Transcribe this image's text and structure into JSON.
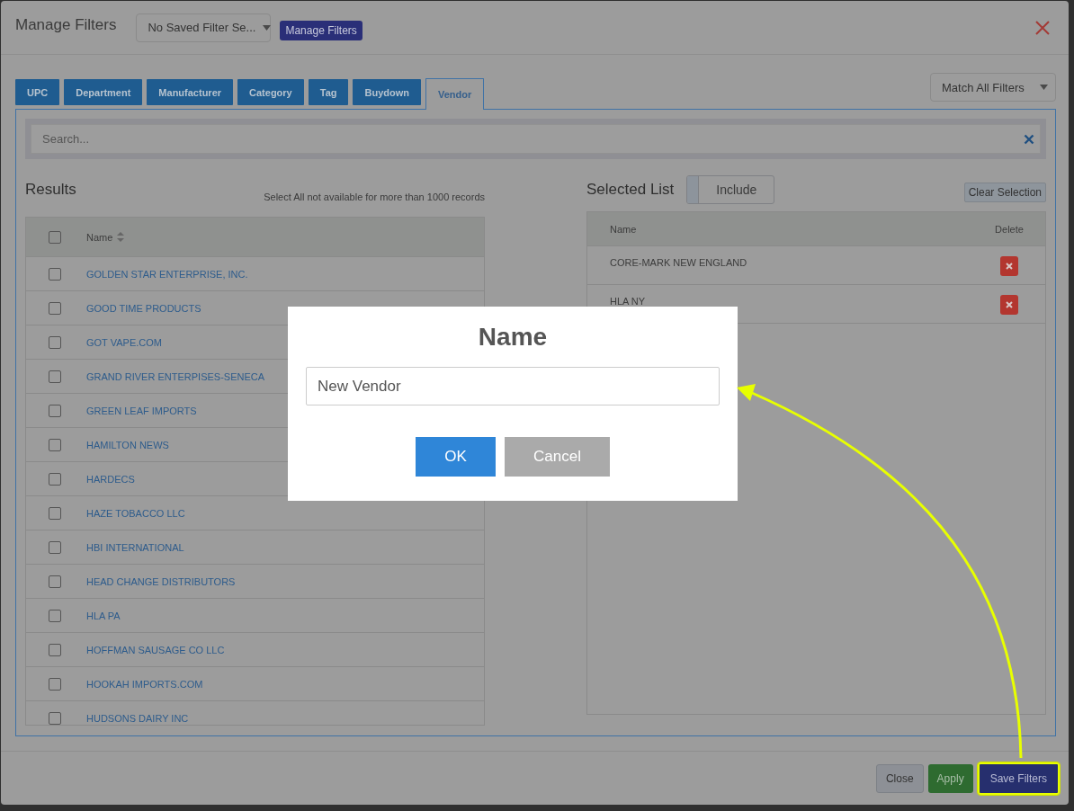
{
  "header": {
    "title": "Manage Filters",
    "saved_filter_select": {
      "value": "No Saved Filter Se..."
    },
    "manage_button": "Manage Filters"
  },
  "tabs": [
    {
      "label": "UPC",
      "selected": false
    },
    {
      "label": "Department",
      "selected": false
    },
    {
      "label": "Manufacturer",
      "selected": false
    },
    {
      "label": "Category",
      "selected": false
    },
    {
      "label": "Tag",
      "selected": false
    },
    {
      "label": "Buydown",
      "selected": false
    },
    {
      "label": "Vendor",
      "selected": true
    }
  ],
  "match_select": {
    "value": "Match All Filters"
  },
  "search": {
    "placeholder": "Search..."
  },
  "results": {
    "title": "Results",
    "note": "Select All not available for more than 1000 records",
    "column": "Name",
    "select_all_checked": false,
    "rows": [
      {
        "name": "GOLDEN STAR ENTERPRISE, INC.",
        "checked": false
      },
      {
        "name": "GOOD TIME PRODUCTS",
        "checked": false
      },
      {
        "name": "GOT VAPE.COM",
        "checked": false
      },
      {
        "name": "GRAND RIVER ENTERPISES-SENECA",
        "checked": false
      },
      {
        "name": "GREEN LEAF IMPORTS",
        "checked": false
      },
      {
        "name": "HAMILTON NEWS",
        "checked": false
      },
      {
        "name": "HARDECS",
        "checked": false
      },
      {
        "name": "HAZE TOBACCO LLC",
        "checked": false
      },
      {
        "name": "HBI INTERNATIONAL",
        "checked": false
      },
      {
        "name": "HEAD CHANGE DISTRIBUTORS",
        "checked": false
      },
      {
        "name": "HLA PA",
        "checked": false
      },
      {
        "name": "HOFFMAN SAUSAGE CO LLC",
        "checked": false
      },
      {
        "name": "HOOKAH IMPORTS.COM",
        "checked": false
      },
      {
        "name": "HUDSONS DAIRY INC",
        "checked": false
      }
    ]
  },
  "selected_list": {
    "title": "Selected List",
    "toggle": {
      "label": "Include",
      "on": false
    },
    "clear_button": "Clear Selection",
    "columns": [
      "Name",
      "Delete"
    ],
    "rows": [
      {
        "name": "CORE-MARK NEW ENGLAND"
      },
      {
        "name": "HLA NY"
      }
    ]
  },
  "footer": {
    "buttons": [
      {
        "label": "Close",
        "kind": "default",
        "highlighted": false
      },
      {
        "label": "Apply",
        "kind": "success",
        "highlighted": false
      },
      {
        "label": "Save Filters",
        "kind": "primary",
        "highlighted": true
      }
    ]
  },
  "dialog": {
    "title": "Name",
    "input_value": "New Vendor",
    "buttons": [
      {
        "label": "OK",
        "kind": "primary"
      },
      {
        "label": "Cancel",
        "kind": "secondary"
      }
    ]
  }
}
